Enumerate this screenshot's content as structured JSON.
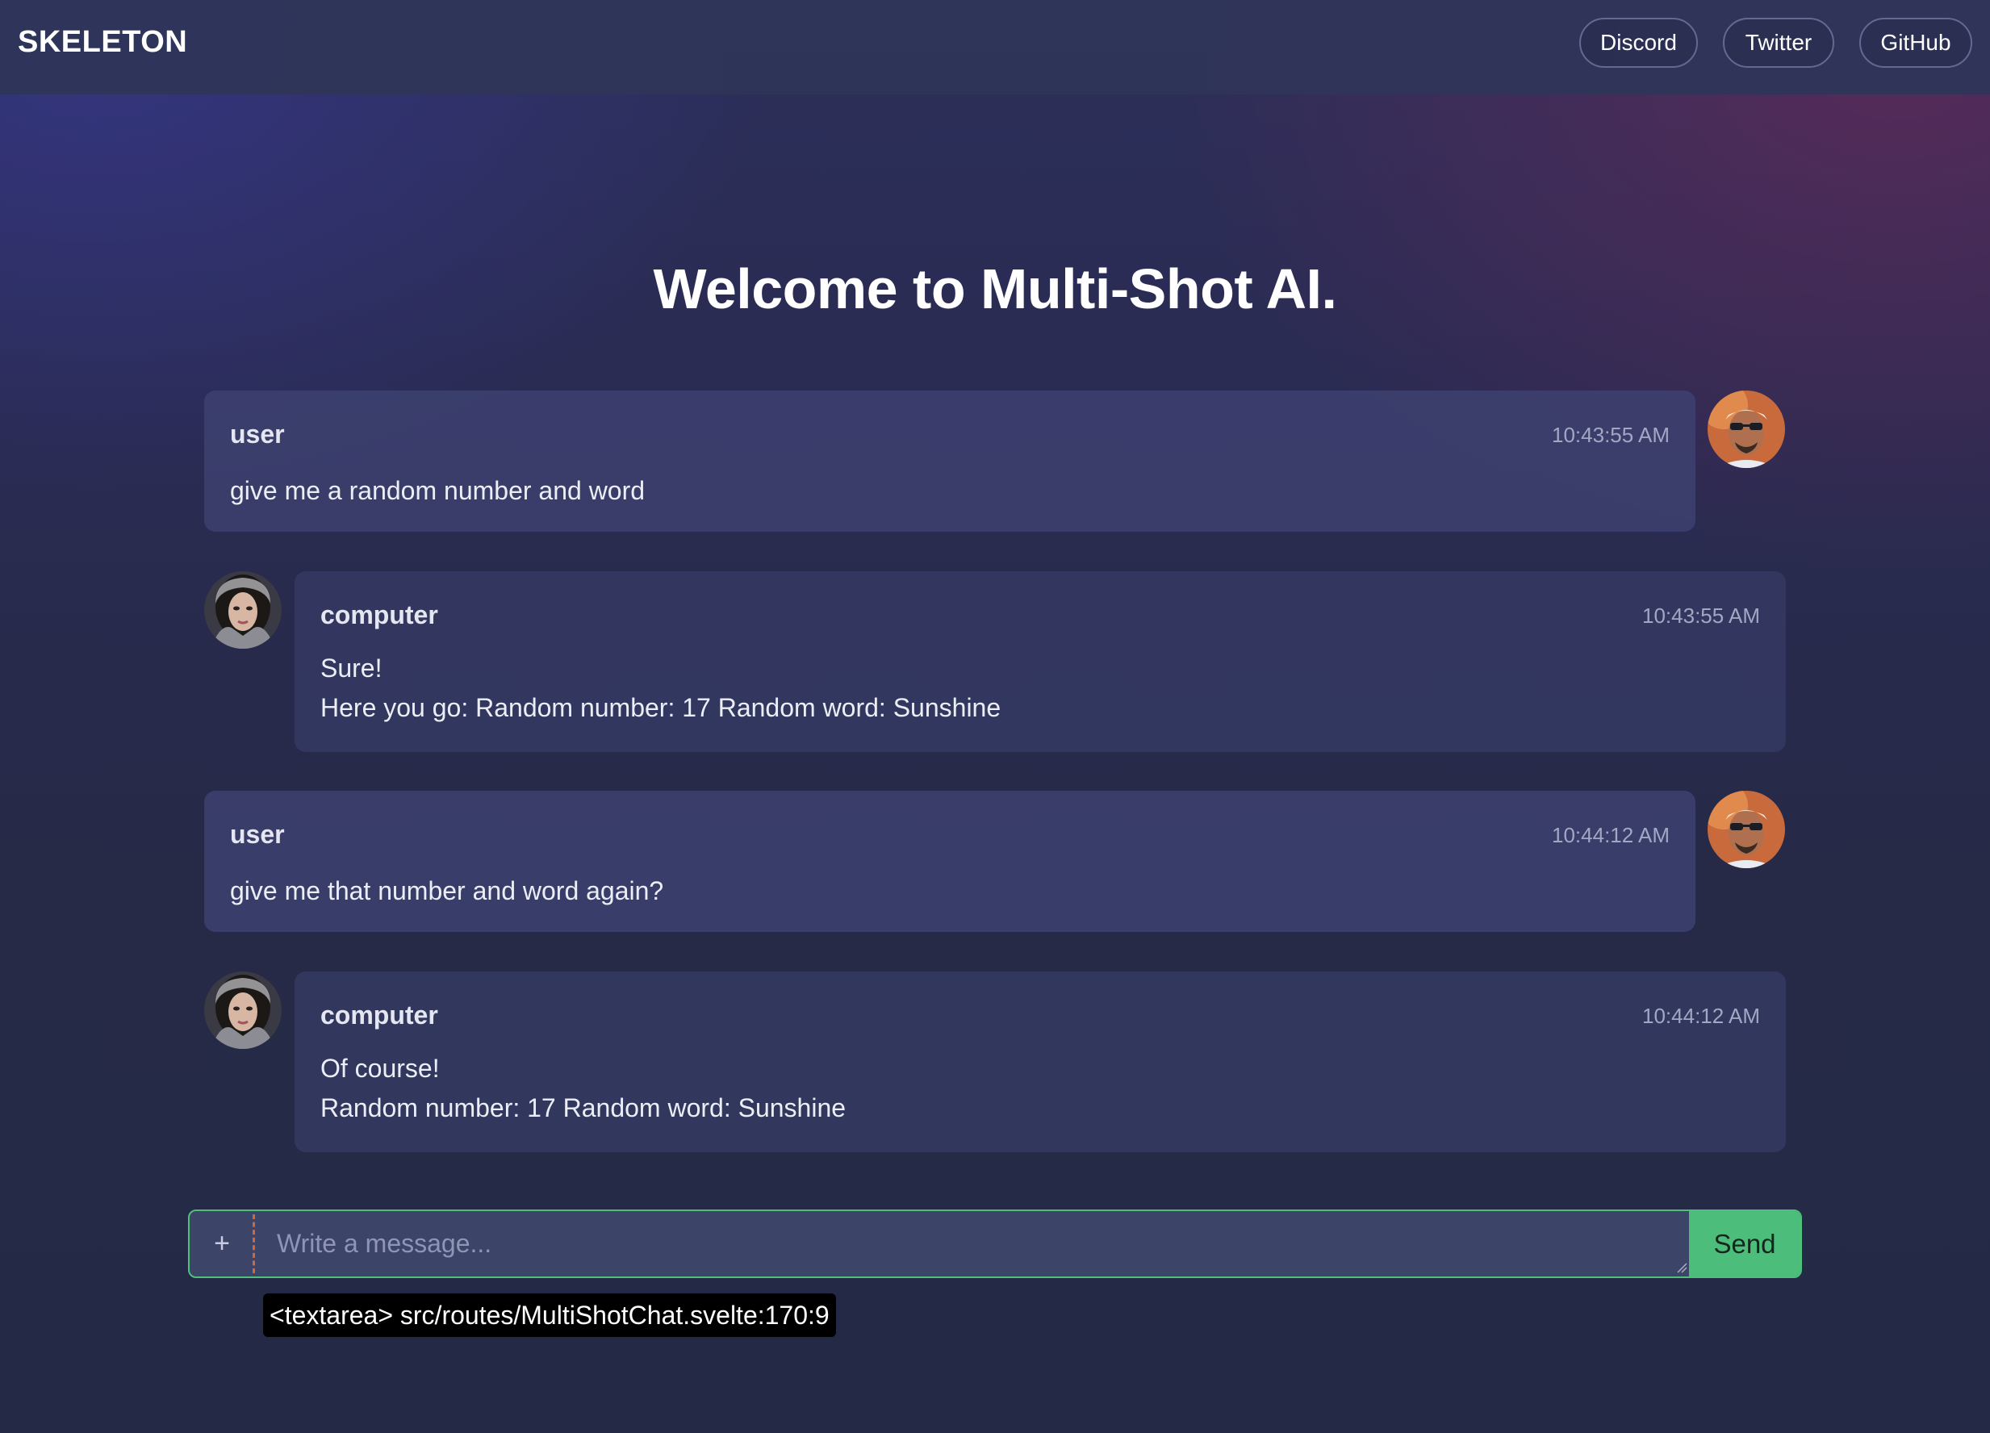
{
  "app": {
    "brand": "SKELETON",
    "nav": [
      {
        "label": "Discord"
      },
      {
        "label": "Twitter"
      },
      {
        "label": "GitHub"
      }
    ]
  },
  "page": {
    "title": "Welcome to Multi-Shot AI."
  },
  "messages": [
    {
      "author": "user",
      "time": "10:43:55 AM",
      "text": "give me a random number and word",
      "avatar": "man-sunglasses-avatar"
    },
    {
      "author": "computer",
      "time": "10:43:55 AM",
      "text": "Sure!\nHere you go: Random number: 17 Random word: Sunshine",
      "avatar": "woman-avatar"
    },
    {
      "author": "user",
      "time": "10:44:12 AM",
      "text": "give me that number and word again?",
      "avatar": "man-sunglasses-avatar"
    },
    {
      "author": "computer",
      "time": "10:44:12 AM",
      "text": "Of course!\nRandom number: 17 Random word: Sunshine",
      "avatar": "woman-avatar"
    }
  ],
  "composer": {
    "add_label": "+",
    "placeholder": "Write a message...",
    "value": "",
    "send_label": "Send",
    "accent_color": "#4cbd7b"
  },
  "devtools": {
    "inspector_tooltip": "<textarea> src/routes/MultiShotChat.svelte:170:9"
  }
}
